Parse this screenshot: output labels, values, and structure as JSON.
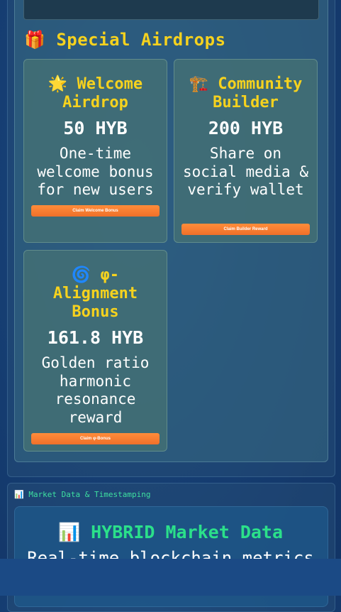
{
  "special_airdrops": {
    "title": "🎁 Special Airdrops",
    "cards": [
      {
        "title": "🌟 Welcome Airdrop",
        "amount": "50 HYB",
        "description": "One-time welcome bonus for new users",
        "button": "Claim Welcome Bonus"
      },
      {
        "title": "🏗️ Community Builder",
        "amount": "200 HYB",
        "description": "Share on social media & verify wallet",
        "button": "Claim Builder Reward"
      },
      {
        "title": "🌀 φ-Alignment Bonus",
        "amount": "161.8 HYB",
        "description": "Golden ratio harmonic resonance reward",
        "button": "Claim φ-Bonus"
      }
    ]
  },
  "market": {
    "title": "📊 Market Data & Timestamping",
    "heading": "📊 HYBRID Market Data",
    "subtitle": "Real-time blockchain metrics"
  },
  "colors": {
    "accent_yellow": "#f6d21e",
    "accent_green": "#2be08a",
    "button_orange": "#f0702a"
  }
}
